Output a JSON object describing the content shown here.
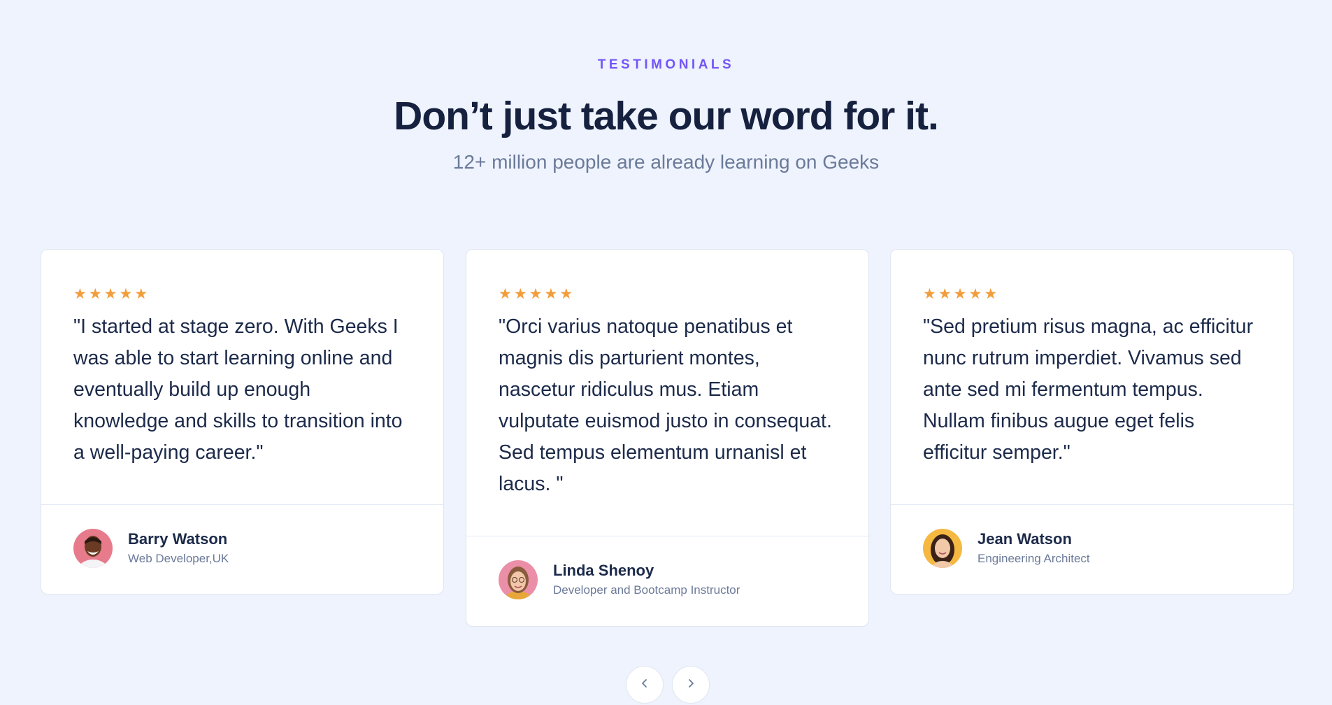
{
  "header": {
    "eyebrow": "TESTIMONIALS",
    "title": "Don’t just take our word for it.",
    "subtitle": "12+ million people are already learning on Geeks"
  },
  "testimonials": [
    {
      "rating": 5,
      "quote": "\"I started at stage zero. With Geeks I was able to start learning online and eventually build up enough knowledge and skills to transition into a well-paying career.\"",
      "name": "Barry Watson",
      "role": "Web Developer,UK"
    },
    {
      "rating": 5,
      "quote": "\"Orci varius natoque penatibus et magnis dis parturient montes, nascetur ridiculus mus. Etiam vulputate euismod justo in consequat. Sed tempus elementum urnanisl et lacus. \"",
      "name": "Linda Shenoy",
      "role": "Developer and Bootcamp Instructor"
    },
    {
      "rating": 5,
      "quote": "\"Sed pretium risus magna, ac efficitur nunc rutrum imperdiet. Vivamus sed ante sed mi fermentum tempus. Nullam finibus augue eget felis efficitur semper.\"",
      "name": "Jean Watson",
      "role": "Engineering Architect"
    }
  ],
  "icons": {
    "star": "star-icon",
    "prev": "chevron-left-icon",
    "next": "chevron-right-icon"
  },
  "colors": {
    "accent": "#7355f7",
    "star": "#f39c3a",
    "background": "#eef3fd"
  }
}
